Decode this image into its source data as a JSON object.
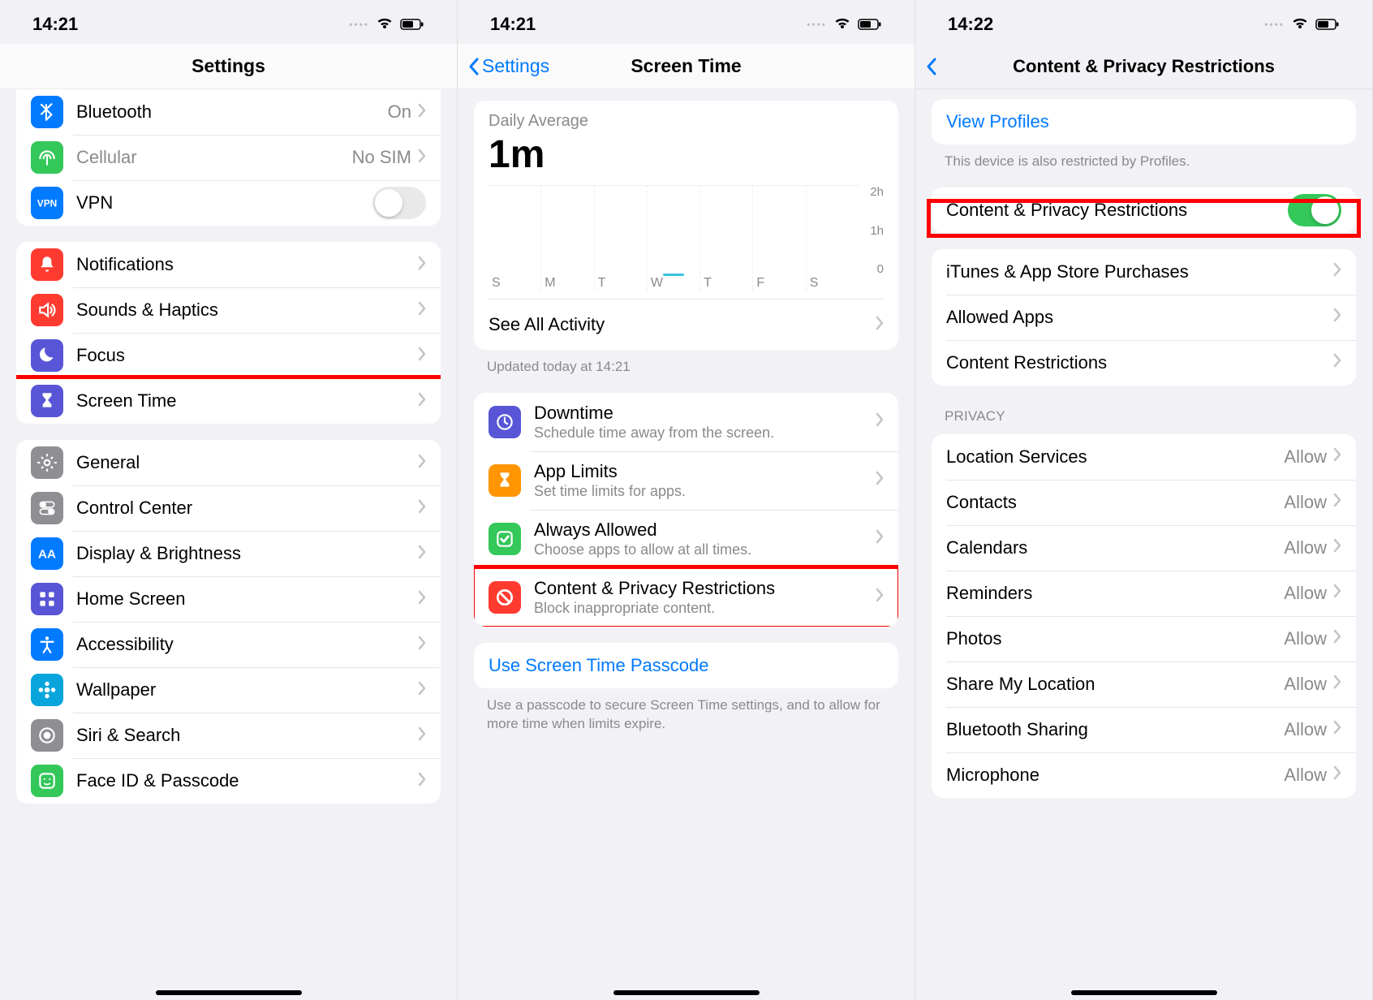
{
  "screens": [
    {
      "time": "14:21",
      "title": "Settings",
      "groups": [
        [
          {
            "icon": "bluetooth",
            "color": "ic-blue",
            "label": "Bluetooth",
            "detail": "On"
          },
          {
            "icon": "antenna",
            "color": "ic-green",
            "label": "Cellular",
            "detail": "No SIM",
            "disabled": true
          },
          {
            "icon": "vpn",
            "color": "ic-vpn",
            "label": "VPN",
            "toggle": false
          }
        ],
        [
          {
            "icon": "bell",
            "color": "ic-red",
            "label": "Notifications"
          },
          {
            "icon": "speaker",
            "color": "ic-red",
            "label": "Sounds & Haptics"
          },
          {
            "icon": "moon",
            "color": "ic-indigo",
            "label": "Focus"
          },
          {
            "icon": "hourglass",
            "color": "ic-indigo",
            "label": "Screen Time",
            "highlight": true
          }
        ],
        [
          {
            "icon": "gear",
            "color": "ic-gray",
            "label": "General"
          },
          {
            "icon": "switches",
            "color": "ic-gray",
            "label": "Control Center"
          },
          {
            "icon": "aa",
            "color": "ic-blue",
            "label": "Display & Brightness"
          },
          {
            "icon": "grid",
            "color": "ic-indigo",
            "label": "Home Screen"
          },
          {
            "icon": "accessibility",
            "color": "ic-blue",
            "label": "Accessibility"
          },
          {
            "icon": "flower",
            "color": "ic-cyan",
            "label": "Wallpaper"
          },
          {
            "icon": "siri",
            "color": "ic-gray",
            "label": "Siri & Search"
          },
          {
            "icon": "faceid",
            "color": "ic-green",
            "label": "Face ID & Passcode"
          }
        ]
      ]
    },
    {
      "time": "14:21",
      "back": "Settings",
      "title": "Screen Time",
      "avg_label": "Daily Average",
      "avg_value": "1m",
      "see_all": "See All Activity",
      "updated": "Updated today at 14:21",
      "features": [
        {
          "icon": "downtime",
          "color": "ic-indigo",
          "label": "Downtime",
          "sub": "Schedule time away from the screen."
        },
        {
          "icon": "hourglass",
          "color": "ic-orange",
          "label": "App Limits",
          "sub": "Set time limits for apps."
        },
        {
          "icon": "check",
          "color": "ic-green",
          "label": "Always Allowed",
          "sub": "Choose apps to allow at all times."
        },
        {
          "icon": "nosign",
          "color": "ic-red",
          "label": "Content & Privacy Restrictions",
          "sub": "Block inappropriate content.",
          "highlight": true
        }
      ],
      "passcode_label": "Use Screen Time Passcode",
      "passcode_footer": "Use a passcode to secure Screen Time settings, and to allow for more time when limits expire."
    },
    {
      "time": "14:22",
      "title": "Content & Privacy Restrictions",
      "view_profiles": "View Profiles",
      "profiles_footer": "This device is also restricted by Profiles.",
      "main_toggle_label": "Content & Privacy Restrictions",
      "main_toggle_on": true,
      "section2": [
        {
          "label": "iTunes & App Store Purchases"
        },
        {
          "label": "Allowed Apps"
        },
        {
          "label": "Content Restrictions"
        }
      ],
      "privacy_header": "PRIVACY",
      "privacy_rows": [
        {
          "label": "Location Services",
          "detail": "Allow"
        },
        {
          "label": "Contacts",
          "detail": "Allow"
        },
        {
          "label": "Calendars",
          "detail": "Allow"
        },
        {
          "label": "Reminders",
          "detail": "Allow"
        },
        {
          "label": "Photos",
          "detail": "Allow"
        },
        {
          "label": "Share My Location",
          "detail": "Allow"
        },
        {
          "label": "Bluetooth Sharing",
          "detail": "Allow"
        },
        {
          "label": "Microphone",
          "detail": "Allow"
        }
      ]
    }
  ],
  "chart_data": {
    "type": "bar",
    "title": "Daily Average",
    "categories": [
      "S",
      "M",
      "T",
      "W",
      "T",
      "F",
      "S"
    ],
    "values": [
      0,
      0,
      0,
      1,
      0,
      0,
      0
    ],
    "ylabel": "minutes",
    "ylim": [
      0,
      120
    ],
    "y_ticks": [
      "2h",
      "1h",
      "0"
    ]
  }
}
